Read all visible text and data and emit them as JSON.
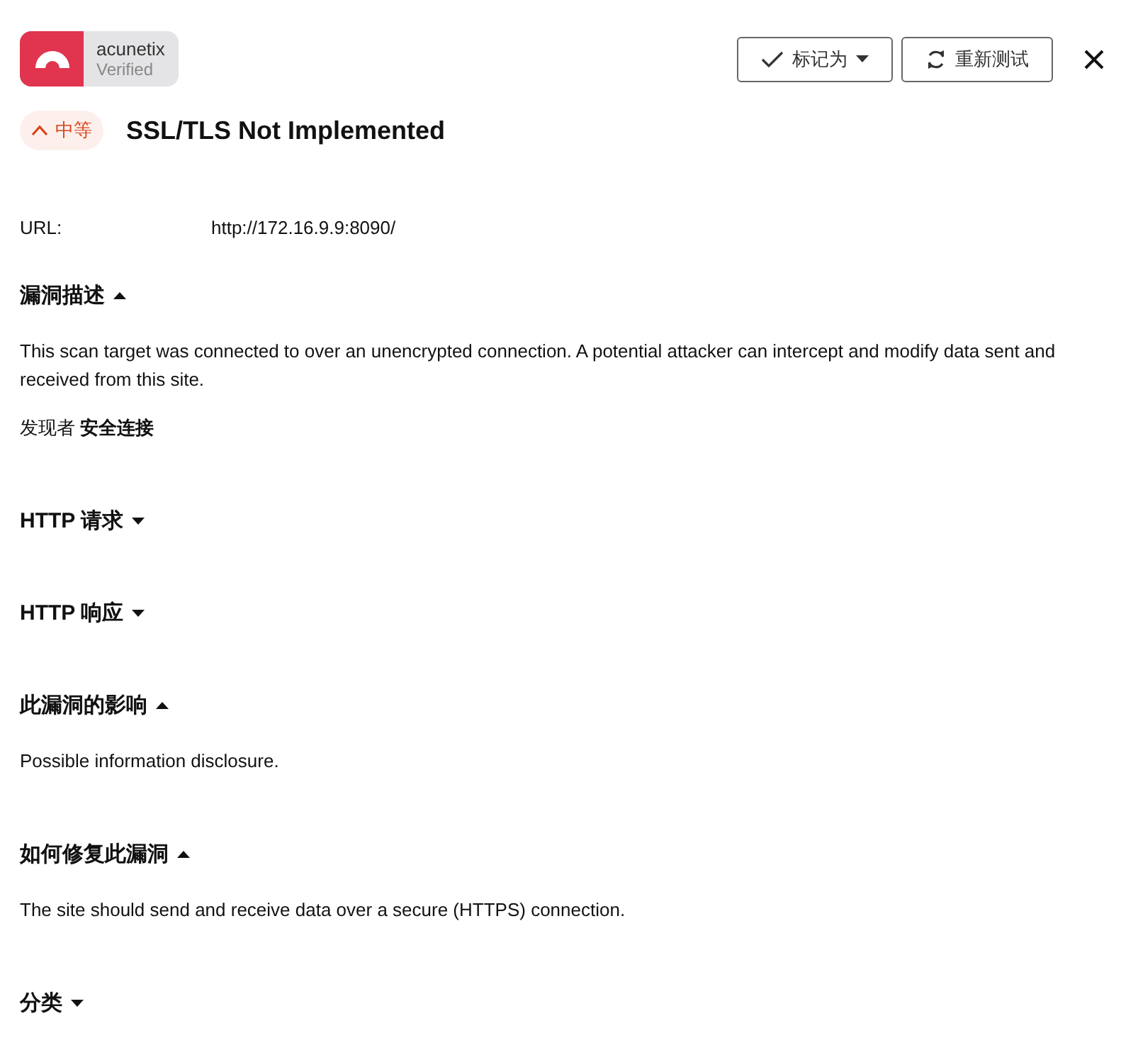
{
  "logo": {
    "name": "acunetix",
    "badge": "Verified"
  },
  "actions": [
    {
      "kind": "mark",
      "label": "标记为"
    },
    {
      "kind": "retest",
      "label": "重新测试"
    }
  ],
  "severity": {
    "label": "中等",
    "color": "#d9441c"
  },
  "title": "SSL/TLS Not Implemented",
  "url": {
    "label": "URL:",
    "value": "http://172.16.9.9:8090/"
  },
  "sections": [
    {
      "title": "漏洞描述",
      "expanded": true,
      "paragraphs": [
        "This scan target was connected to over an unencrypted connection. A potential attacker can intercept and modify data sent and received from this site.",
        "发现者 **安全连接**"
      ]
    },
    {
      "title": "HTTP 请求",
      "expanded": false
    },
    {
      "title": "HTTP 响应",
      "expanded": false
    },
    {
      "title": "此漏洞的影响",
      "expanded": true,
      "paragraphs": [
        "Possible information disclosure."
      ]
    },
    {
      "title": "如何修复此漏洞",
      "expanded": true,
      "paragraphs": [
        "The site should send and receive data over a secure (HTTPS) connection."
      ]
    },
    {
      "title": "分类",
      "expanded": false
    }
  ]
}
